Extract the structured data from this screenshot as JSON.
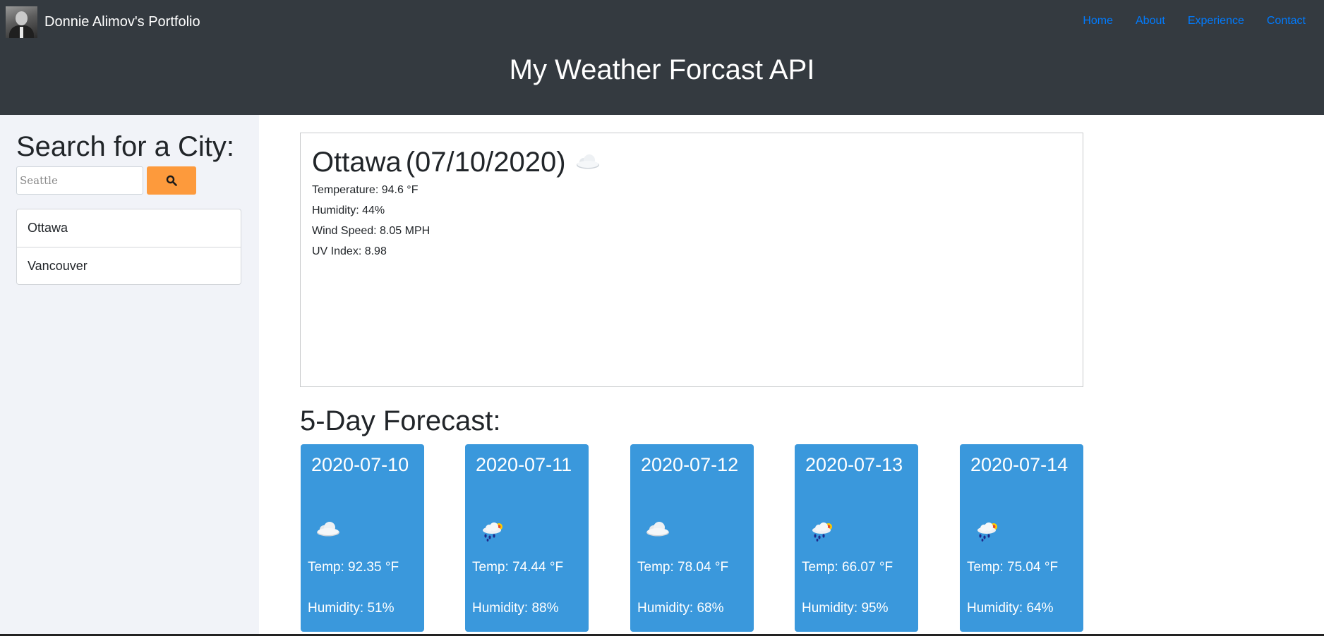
{
  "navbar": {
    "brand": "Donnie Alimov's Portfolio",
    "links": [
      "Home",
      "About",
      "Experience",
      "Contact"
    ]
  },
  "hero": {
    "title": "My Weather Forcast API"
  },
  "sidebar": {
    "heading": "Search for a City:",
    "search": {
      "placeholder": "Seattle",
      "button_icon": "search-icon",
      "button_color": "#fd9a3c"
    },
    "cities": [
      "Ottawa",
      "Vancouver"
    ]
  },
  "current": {
    "city": "Ottawa",
    "date": "(07/10/2020)",
    "icon": "cloud-icon",
    "temperature": "Temperature: 94.6 °F",
    "humidity": "Humidity: 44%",
    "wind": "Wind Speed: 8.05 MPH",
    "uv": "UV Index: 8.98"
  },
  "forecast": {
    "title": "5-Day Forecast:",
    "card_color": "#3a98dc",
    "days": [
      {
        "date": "2020-07-10",
        "icon": "cloud-icon",
        "temp": "Temp: 92.35 °F",
        "humidity": "Humidity: 51%"
      },
      {
        "date": "2020-07-11",
        "icon": "rain-sun-icon",
        "temp": "Temp: 74.44 °F",
        "humidity": "Humidity: 88%"
      },
      {
        "date": "2020-07-12",
        "icon": "cloud-icon",
        "temp": "Temp: 78.04 °F",
        "humidity": "Humidity: 68%"
      },
      {
        "date": "2020-07-13",
        "icon": "rain-sun-icon",
        "temp": "Temp: 66.07 °F",
        "humidity": "Humidity: 95%"
      },
      {
        "date": "2020-07-14",
        "icon": "rain-sun-icon",
        "temp": "Temp: 75.04 °F",
        "humidity": "Humidity: 64%"
      }
    ]
  }
}
